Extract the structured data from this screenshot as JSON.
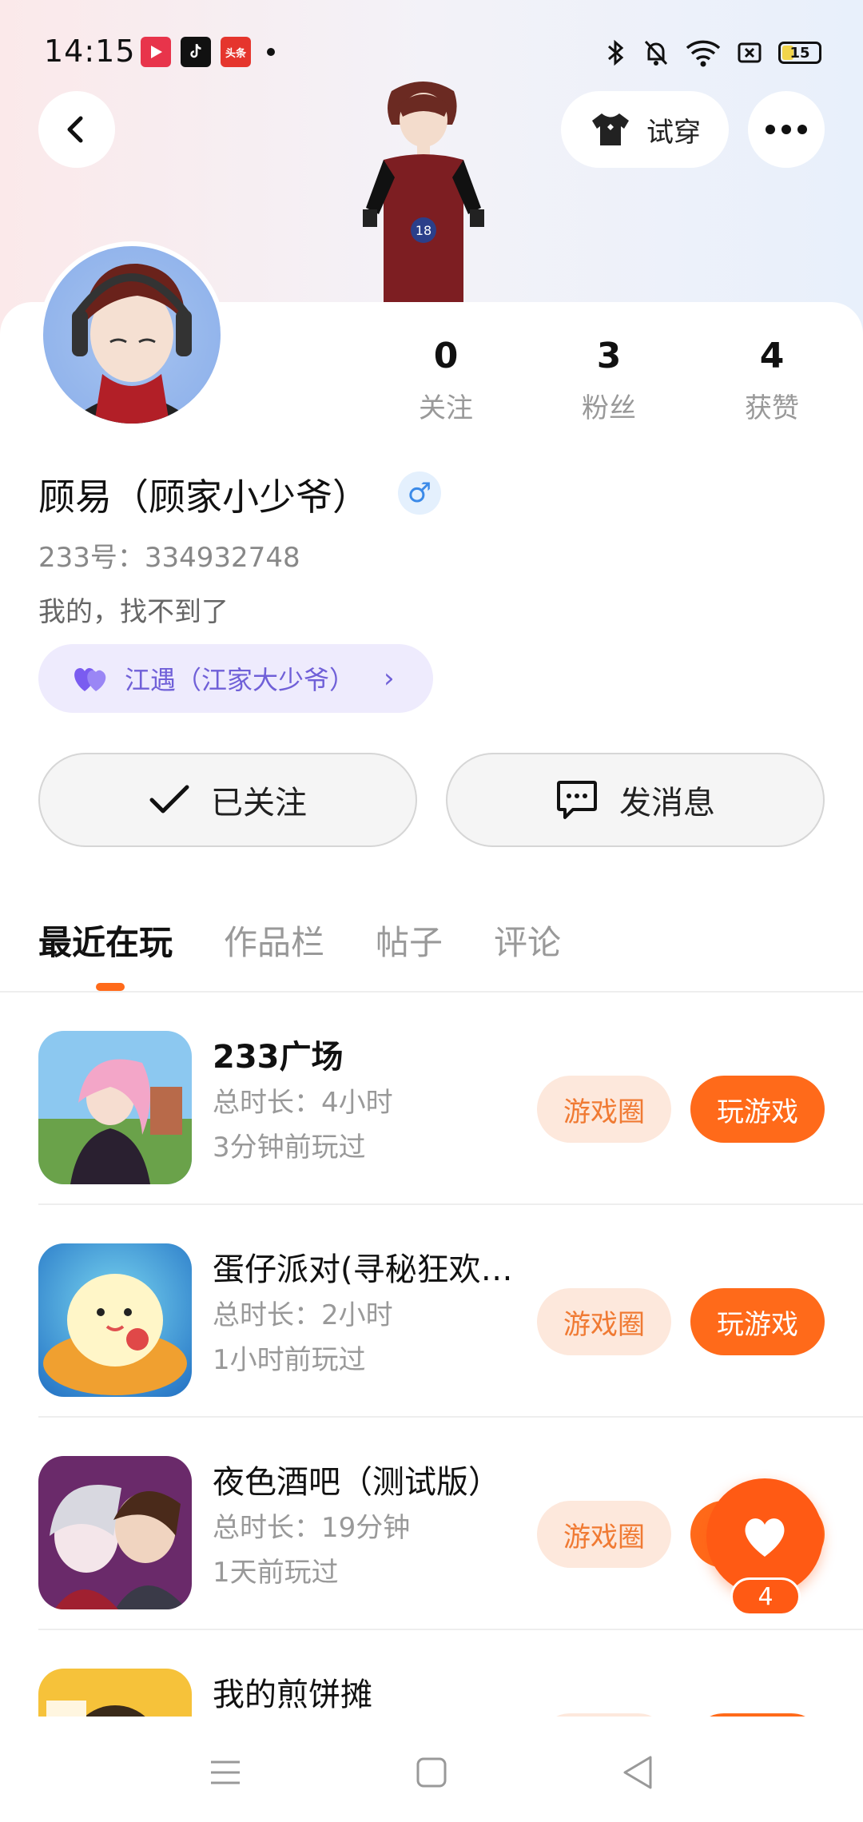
{
  "status_bar": {
    "time": "14:15",
    "apps": [
      "video-app-icon",
      "tiktok-icon",
      "toutiao-icon"
    ],
    "toutiao_label": "头条",
    "battery": "15"
  },
  "header": {
    "try_on_label": "试穿"
  },
  "profile": {
    "stats": [
      {
        "value": "0",
        "label": "关注"
      },
      {
        "value": "3",
        "label": "粉丝"
      },
      {
        "value": "4",
        "label": "获赞"
      }
    ],
    "name": "顾易（顾家小少爷）",
    "gender_symbol": "♂",
    "id_line": "233号：334932748",
    "bio": "我的，找不到了",
    "couple": "江遇（江家大少爷）"
  },
  "actions": {
    "followed_label": "已关注",
    "message_label": "发消息"
  },
  "tabs": [
    "最近在玩",
    "作品栏",
    "帖子",
    "评论"
  ],
  "games": [
    {
      "title": "233广场",
      "duration": "总时长：4小时",
      "last_played": "3分钟前玩过"
    },
    {
      "title": "蛋仔派对(寻秘狂欢…",
      "duration": "总时长：2小时",
      "last_played": "1小时前玩过"
    },
    {
      "title": "夜色酒吧（测试版）",
      "duration": "总时长：19分钟",
      "last_played": "1天前玩过"
    },
    {
      "title": "我的煎饼摊",
      "duration": "",
      "last_played": ""
    }
  ],
  "game_buttons": {
    "circle_label": "游戏圈",
    "play_label": "玩游戏"
  },
  "like_fab": {
    "count": "4"
  },
  "colors": {
    "accent": "#ff6a1a",
    "accent_soft": "#fde8dc",
    "couple_bg": "#eeebfd",
    "couple_text": "#7060d8"
  }
}
